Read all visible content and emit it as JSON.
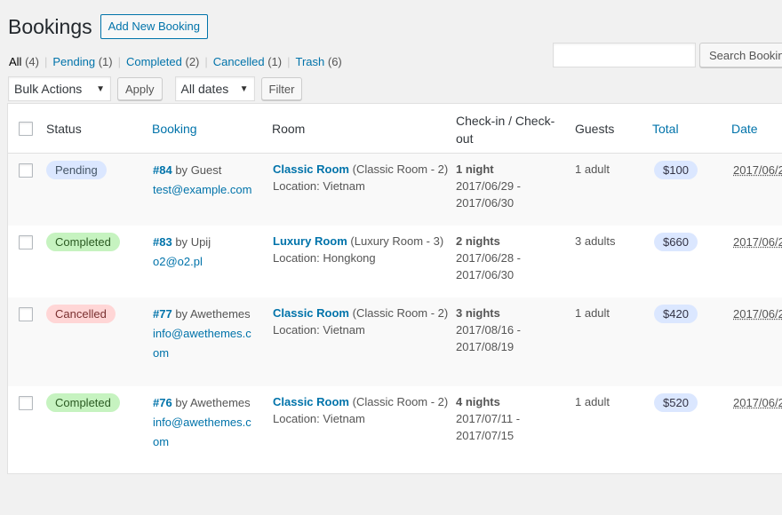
{
  "page": {
    "title": "Bookings",
    "add_new_label": "Add New Booking"
  },
  "filters": {
    "views": [
      {
        "label": "All",
        "count": "(4)"
      },
      {
        "label": "Pending",
        "count": "(1)"
      },
      {
        "label": "Completed",
        "count": "(2)"
      },
      {
        "label": "Cancelled",
        "count": "(1)"
      },
      {
        "label": "Trash",
        "count": "(6)"
      }
    ],
    "separator": "|"
  },
  "search": {
    "placeholder": "",
    "button_label": "Search Bookings"
  },
  "tablenav": {
    "bulk_actions": "Bulk Actions",
    "apply_label": "Apply",
    "dates": "All dates",
    "filter_label": "Filter"
  },
  "columns": {
    "status": "Status",
    "booking": "Booking",
    "room": "Room",
    "checkin_line1": "Check-in / Check-",
    "checkin_line2": "out",
    "guests": "Guests",
    "total": "Total",
    "date": "Date"
  },
  "rows": [
    {
      "status": "Pending",
      "booking_id": "#84",
      "by_label": "by",
      "customer": "Guest",
      "email_lines": [
        "test@example.com"
      ],
      "room_name": "Classic Room",
      "room_detail": "(Classic Room - 2)",
      "location": "Location: Vietnam",
      "nights": "1 night",
      "checkin": "2017/06/29 -",
      "checkout": "2017/06/30",
      "guests": "1 adult",
      "total": "$100",
      "date": "2017/06/2"
    },
    {
      "status": "Completed",
      "booking_id": "#83",
      "by_label": "by",
      "customer": "Upij",
      "email_lines": [
        "o2@o2.pl"
      ],
      "room_name": "Luxury Room",
      "room_detail": "(Luxury Room - 3)",
      "location": "Location: Hongkong",
      "nights": "2 nights",
      "checkin": "2017/06/28 -",
      "checkout": "2017/06/30",
      "guests": "3 adults",
      "total": "$660",
      "date": "2017/06/2"
    },
    {
      "status": "Cancelled",
      "booking_id": "#77",
      "by_label": "by",
      "customer": "Awethemes",
      "email_lines": [
        "info@awethemes.c",
        "om"
      ],
      "room_name": "Classic Room",
      "room_detail": "(Classic Room - 2)",
      "location": "Location: Vietnam",
      "nights": "3 nights",
      "checkin": "2017/08/16 -",
      "checkout": "2017/08/19",
      "guests": "1 adult",
      "total": "$420",
      "date": "2017/06/2"
    },
    {
      "status": "Completed",
      "booking_id": "#76",
      "by_label": "by",
      "customer": "Awethemes",
      "email_lines": [
        "info@awethemes.c",
        "om"
      ],
      "room_name": "Classic Room",
      "room_detail": "(Classic Room - 2)",
      "location": "Location: Vietnam",
      "nights": "4 nights",
      "checkin": "2017/07/11 -",
      "checkout": "2017/07/15",
      "guests": "1 adult",
      "total": "$520",
      "date": "2017/06/2"
    }
  ],
  "colors": {
    "link": "#0073aa",
    "pending_bg": "#dbe7ff",
    "completed_bg": "#c6f3c0",
    "cancelled_bg": "#ffd6d6"
  }
}
